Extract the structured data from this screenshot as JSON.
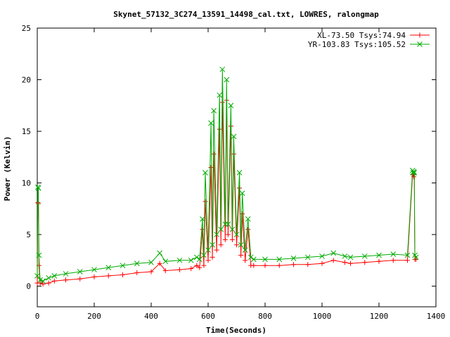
{
  "chart_data": {
    "type": "line",
    "title": "Skynet_57132_3C274_13591_14498_cal.txt, LOWRES, ralongmap",
    "xlabel": "Time(Seconds)",
    "ylabel": "Power (Kelvin)",
    "xlim": [
      0,
      1400
    ],
    "ylim": [
      -2,
      25
    ],
    "xticks": [
      0,
      200,
      400,
      600,
      800,
      1000,
      1200,
      1400
    ],
    "yticks": [
      0,
      5,
      10,
      15,
      20,
      25
    ],
    "grid": false,
    "legend_position": "top-right",
    "series": [
      {
        "name": "XL-73.50 Tsys:74.94",
        "color": "#ff0000",
        "marker": "plus",
        "x": [
          0,
          2,
          4,
          6,
          10,
          20,
          40,
          60,
          100,
          150,
          200,
          250,
          300,
          350,
          400,
          430,
          450,
          500,
          540,
          560,
          570,
          580,
          585,
          590,
          600,
          610,
          615,
          620,
          630,
          640,
          645,
          650,
          660,
          665,
          670,
          680,
          685,
          690,
          700,
          710,
          715,
          720,
          730,
          740,
          750,
          760,
          800,
          850,
          900,
          950,
          1000,
          1040,
          1080,
          1100,
          1150,
          1200,
          1250,
          1300,
          1318,
          1320,
          1322,
          1324,
          1326,
          1330
        ],
        "y": [
          0.3,
          8.1,
          8.0,
          2.0,
          0.3,
          0.2,
          0.3,
          0.5,
          0.6,
          0.7,
          0.9,
          1.0,
          1.1,
          1.3,
          1.4,
          2.2,
          1.5,
          1.6,
          1.7,
          2.0,
          1.8,
          5.5,
          2.0,
          8.2,
          2.5,
          11.5,
          2.8,
          12.8,
          3.5,
          15.2,
          4.0,
          17.8,
          4.5,
          18.0,
          5.0,
          15.5,
          4.5,
          12.8,
          4.0,
          9.5,
          3.0,
          7.0,
          2.5,
          5.5,
          2.0,
          2.0,
          2.0,
          2.0,
          2.1,
          2.1,
          2.2,
          2.5,
          2.3,
          2.2,
          2.3,
          2.4,
          2.5,
          2.5,
          10.8,
          10.8,
          10.6,
          10.8,
          2.6,
          2.6
        ]
      },
      {
        "name": "YR-103.83 Tsys:105.52",
        "color": "#00aa00",
        "marker": "cross",
        "x": [
          0,
          2,
          4,
          6,
          10,
          20,
          40,
          60,
          100,
          150,
          200,
          250,
          300,
          350,
          400,
          430,
          450,
          500,
          540,
          560,
          570,
          580,
          585,
          590,
          600,
          610,
          615,
          620,
          630,
          640,
          645,
          650,
          660,
          665,
          670,
          680,
          685,
          690,
          700,
          710,
          715,
          720,
          730,
          740,
          750,
          760,
          800,
          850,
          900,
          950,
          1000,
          1040,
          1080,
          1100,
          1150,
          1200,
          1250,
          1300,
          1318,
          1320,
          1322,
          1324,
          1326,
          1330
        ],
        "y": [
          1.0,
          9.6,
          9.5,
          3.0,
          0.6,
          0.5,
          0.8,
          1.0,
          1.2,
          1.4,
          1.6,
          1.8,
          2.0,
          2.2,
          2.3,
          3.2,
          2.4,
          2.5,
          2.5,
          2.8,
          2.6,
          6.5,
          3.0,
          11.0,
          3.5,
          15.8,
          4.0,
          17.0,
          5.0,
          18.5,
          5.5,
          21.0,
          6.0,
          20.0,
          6.0,
          17.5,
          5.5,
          14.5,
          5.0,
          11.0,
          4.0,
          9.0,
          3.5,
          6.5,
          2.8,
          2.6,
          2.6,
          2.6,
          2.7,
          2.8,
          2.9,
          3.2,
          2.9,
          2.8,
          2.9,
          3.0,
          3.1,
          3.0,
          11.2,
          11.0,
          11.1,
          11.0,
          3.0,
          2.8
        ]
      }
    ]
  }
}
